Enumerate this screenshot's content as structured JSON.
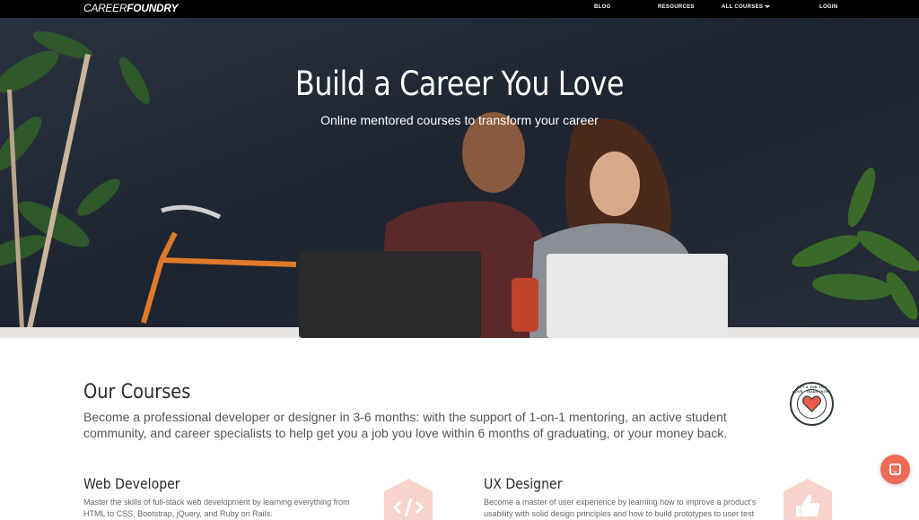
{
  "nav": {
    "logo_part1": "CAREER",
    "logo_part2": "FOUNDRY",
    "blog": "BLOG",
    "resources": "RESOURCES",
    "all_courses": "ALL COURSES",
    "login": "LOGIN"
  },
  "hero": {
    "title": "Build a Career You Love",
    "subtitle": "Online mentored courses to transform your career"
  },
  "courses": {
    "title": "Our Courses",
    "description": "Become a professional developer or designer in 3-6 months: with the support of 1-on-1 mentoring, an active student community, and career specialists to help get you a job you love within 6 months of graduating, or your money back.",
    "badge_text": "GET A JOB YOU LOVE · GUARANTEE",
    "items": [
      {
        "title": "Web Developer",
        "description": "Master the skills of full-stack web development by learning everything from HTML to CSS, Bootstrap, jQuery, and Ruby on Rails.",
        "icon": "code-icon"
      },
      {
        "title": "UX Designer",
        "description": "Become a master of user experience by learning how to improve a product's usability with solid design principles and how to build prototypes to user test",
        "icon": "thumbs-up-icon"
      }
    ]
  },
  "colors": {
    "accent": "#ef6b55",
    "icon_hex": "#f8d3cc",
    "nav_bg": "#000000"
  }
}
